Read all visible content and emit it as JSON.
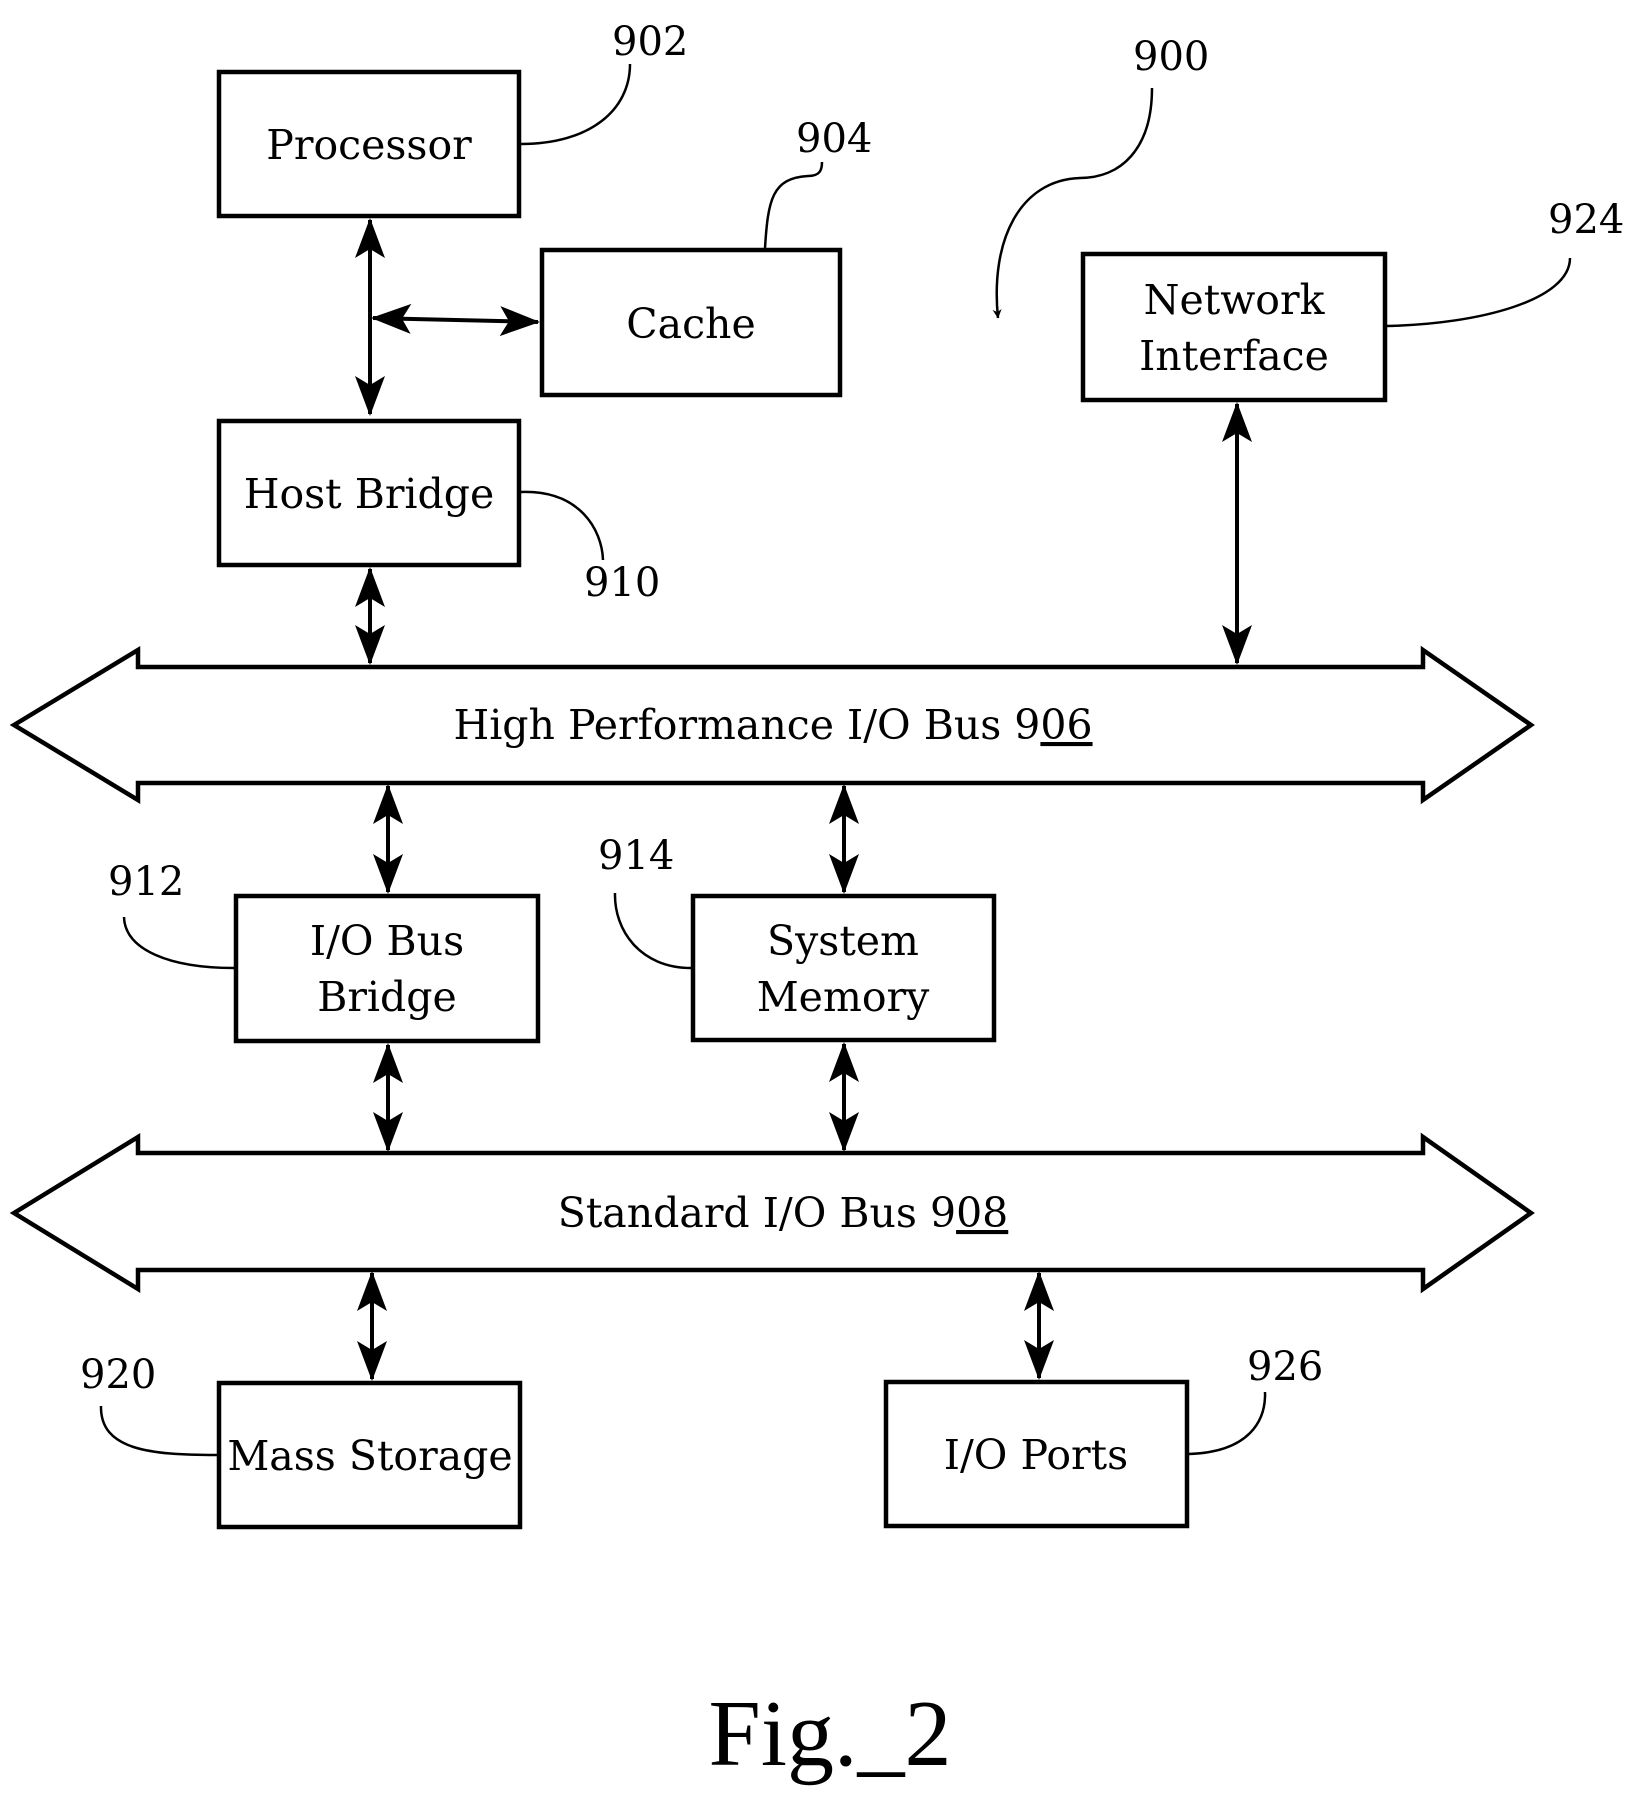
{
  "figure": {
    "caption": "Fig._2",
    "system_ref": "900"
  },
  "blocks": {
    "processor": {
      "label": "Processor",
      "ref": "902"
    },
    "cache": {
      "label": "Cache",
      "ref": "904"
    },
    "host_bridge": {
      "label": "Host Bridge",
      "ref": "910"
    },
    "network_interface": {
      "label_line1": "Network",
      "label_line2": "Interface",
      "ref": "924"
    },
    "io_bus_bridge": {
      "label_line1": "I/O Bus",
      "label_line2": "Bridge",
      "ref": "912"
    },
    "system_memory": {
      "label_line1": "System",
      "label_line2": "Memory",
      "ref": "914"
    },
    "mass_storage": {
      "label": "Mass Storage",
      "ref": "920"
    },
    "io_ports": {
      "label": "I/O Ports",
      "ref": "926"
    }
  },
  "buses": {
    "high_performance": {
      "label": "High Performance I/O Bus 9",
      "ref_suffix": "06"
    },
    "standard": {
      "label": "Standard I/O Bus 9",
      "ref_suffix": "08"
    }
  }
}
